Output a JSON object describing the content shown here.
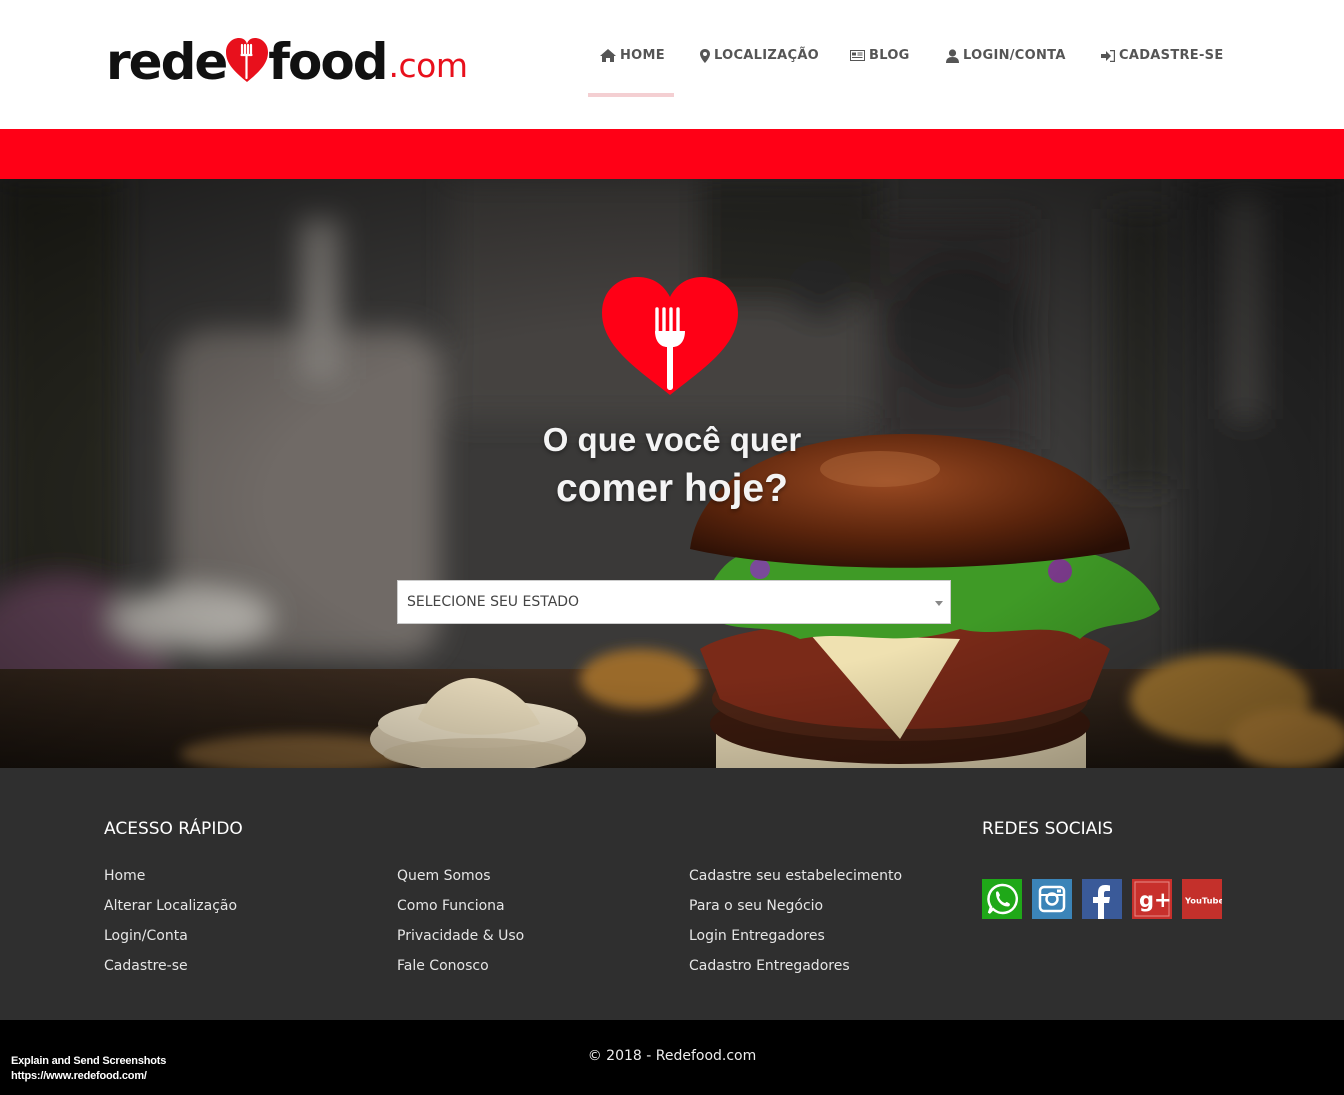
{
  "brand": {
    "logo_part1": "rede",
    "logo_part2": "food",
    "logo_suffix": ".com",
    "accent_color": "#ff0016"
  },
  "nav": {
    "items": [
      {
        "label": "HOME",
        "icon": "home-icon",
        "active": true
      },
      {
        "label": "LOCALIZAÇÃO",
        "icon": "map-marker-icon"
      },
      {
        "label": "BLOG",
        "icon": "newspaper-icon"
      },
      {
        "label": "LOGIN/CONTA",
        "icon": "user-icon"
      },
      {
        "label": "CADASTRE-SE",
        "icon": "sign-in-icon"
      }
    ]
  },
  "hero": {
    "icon": "heart-fork-icon",
    "title_line1": "O que você quer",
    "title_line2": "comer hoje?",
    "state_select": {
      "value": "SELECIONE SEU ESTADO"
    }
  },
  "footer": {
    "quick_access_title": "ACESSO RÁPIDO",
    "col1": [
      "Home",
      "Alterar Localização",
      "Login/Conta",
      "Cadastre-se"
    ],
    "col2": [
      "Quem Somos",
      "Como Funciona",
      "Privacidade & Uso",
      "Fale Conosco"
    ],
    "col3": [
      "Cadastre seu estabelecimento",
      "Para o seu Negócio",
      "Login Entregadores",
      "Cadastro Entregadores"
    ],
    "social_title": "REDES SOCIAIS",
    "social": [
      {
        "name": "whatsapp-icon",
        "color": "#1fa818"
      },
      {
        "name": "instagram-icon",
        "color": "#3b84b8"
      },
      {
        "name": "facebook-icon",
        "color": "#3a5a99"
      },
      {
        "name": "google-plus-icon",
        "color": "#c8302c",
        "text": "g+"
      },
      {
        "name": "youtube-icon",
        "color": "#c4302b",
        "text": "YouTube"
      }
    ]
  },
  "bottom": {
    "copyright": "© 2018 - Redefood.com",
    "overlay_line1": "Explain and Send Screenshots",
    "overlay_line2": "https://www.redefood.com/"
  }
}
